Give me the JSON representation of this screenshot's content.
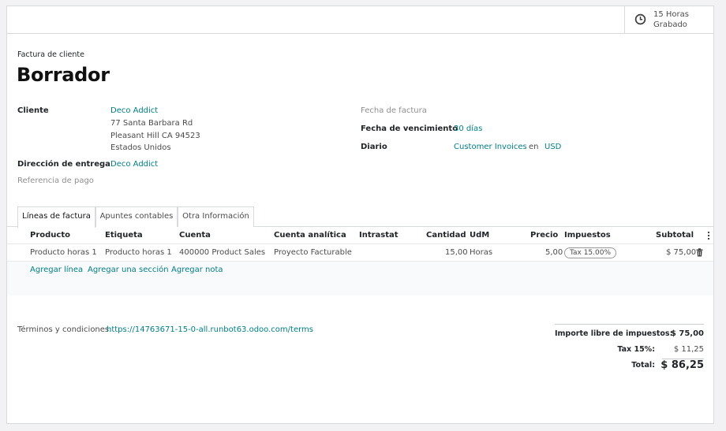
{
  "timesheet": {
    "hours": "15 Horas",
    "status": "Grabado",
    "icon": "clock-icon"
  },
  "header": {
    "doc_type": "Factura de cliente",
    "title": "Borrador"
  },
  "fields": {
    "cliente_label": "Cliente",
    "cliente_name": "Deco Addict",
    "address": [
      "77 Santa Barbara Rd",
      "Pleasant Hill CA 94523",
      "Estados Unidos"
    ],
    "entrega_label": "Dirección de entrega",
    "entrega_value": "Deco Addict",
    "ref_pago_label": "Referencia de pago",
    "fecha_factura_label": "Fecha de factura",
    "vencimiento_label": "Fecha de vencimiento",
    "vencimiento_value": "30 días",
    "diario_label": "Diario",
    "diario_value": "Customer Invoices",
    "diario_en": "en",
    "currency": "USD"
  },
  "tabs": [
    "Líneas de factura",
    "Apuntes contables",
    "Otra Información"
  ],
  "table": {
    "headers": [
      "Producto",
      "Etiqueta",
      "Cuenta",
      "Cuenta analítica",
      "Intrastat",
      "Cantidad",
      "UdM",
      "Precio",
      "Impuestos",
      "Subtotal"
    ],
    "rows": [
      {
        "producto": "Producto horas 1",
        "etiqueta": "Producto horas 1",
        "cuenta": "400000 Product Sales",
        "analitica": "Proyecto Facturable",
        "intrastat": "",
        "cantidad": "15,00",
        "udm": "Horas",
        "precio": "5,00",
        "impuestos": "Tax 15.00%",
        "subtotal": "$ 75,00"
      }
    ],
    "actions": [
      "Agregar línea",
      "Agregar una sección",
      "Agregar nota"
    ]
  },
  "terms": {
    "label": "Términos y condiciones:",
    "url": "https://14763671-15-0-all.runbot63.odoo.com/terms"
  },
  "totals": {
    "untaxed_label": "Importe libre de impuestos:",
    "untaxed_value": "$ 75,00",
    "tax_label": "Tax 15%:",
    "tax_value": "$ 11,25",
    "total_label": "Total:",
    "total_value": "$ 86,25"
  },
  "colors": {
    "link": "#017e84",
    "border": "#d8dadd"
  }
}
